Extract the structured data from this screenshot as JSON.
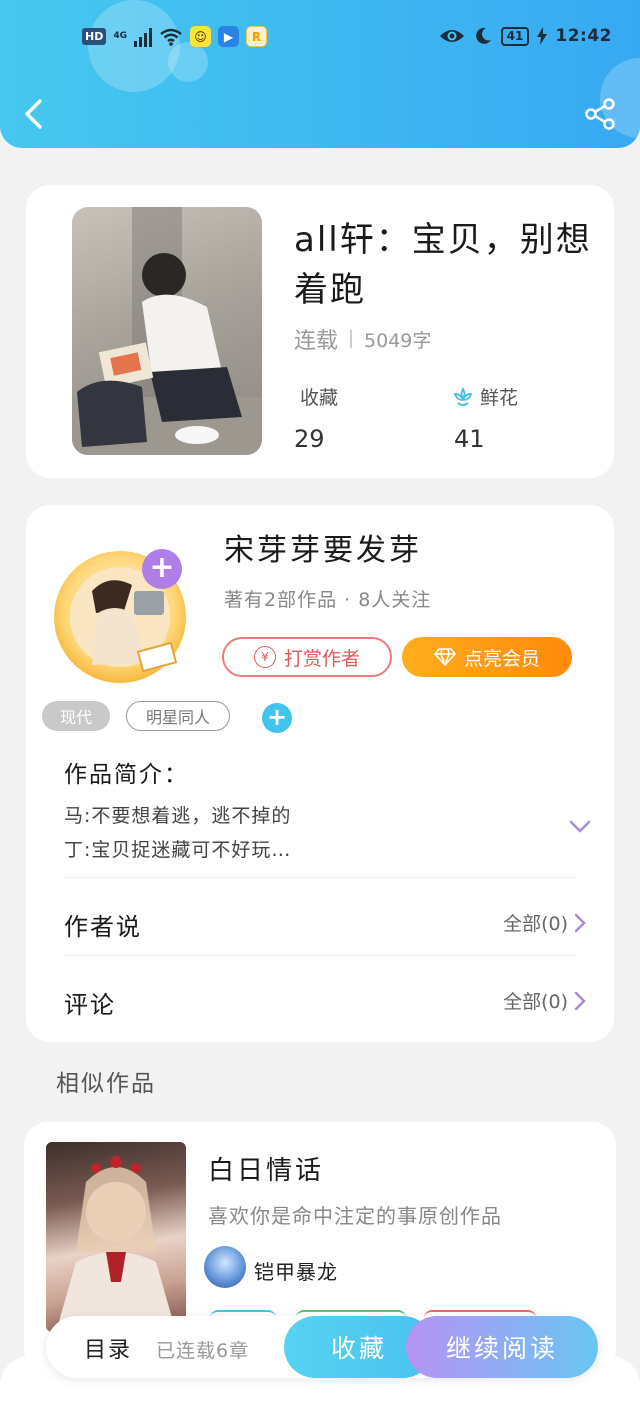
{
  "status_bar": {
    "hd": "HD",
    "network": "4G",
    "battery": "41",
    "time": "12:42"
  },
  "book": {
    "title": "all轩：宝贝，别想着跑",
    "status": "连载",
    "word_count": "5049字",
    "favorites_label": "收藏",
    "favorites_count": "29",
    "flowers_label": "鲜花",
    "flowers_count": "41"
  },
  "author": {
    "name": "宋芽芽要发芽",
    "meta": "著有2部作品 · 8人关注",
    "tip_label": "打赏作者",
    "vip_label": "点亮会员"
  },
  "tags": [
    "现代",
    "明星同人"
  ],
  "intro": {
    "heading": "作品简介：",
    "lines": [
      "马:不要想着逃，逃不掉的",
      "丁:宝贝捉迷藏可不好玩…"
    ]
  },
  "rows": {
    "author_says": {
      "label": "作者说",
      "value": "全部(0)"
    },
    "comments": {
      "label": "评论",
      "value": "全部(0)"
    }
  },
  "similar": {
    "section_title": "相似作品",
    "title": "白日情话",
    "desc": "喜欢你是命中注定的事原创作品",
    "author": "铠甲暴龙"
  },
  "bottom": {
    "toc": "目录",
    "updated": "已连载6章",
    "fav_button": "收藏",
    "read_button": "继续阅读"
  },
  "colors": {
    "header_blue": "#3eb6f1",
    "accent_purple": "#b07ee8",
    "tip_red": "#e05a5a",
    "vip_orange": "#ff8a08"
  }
}
